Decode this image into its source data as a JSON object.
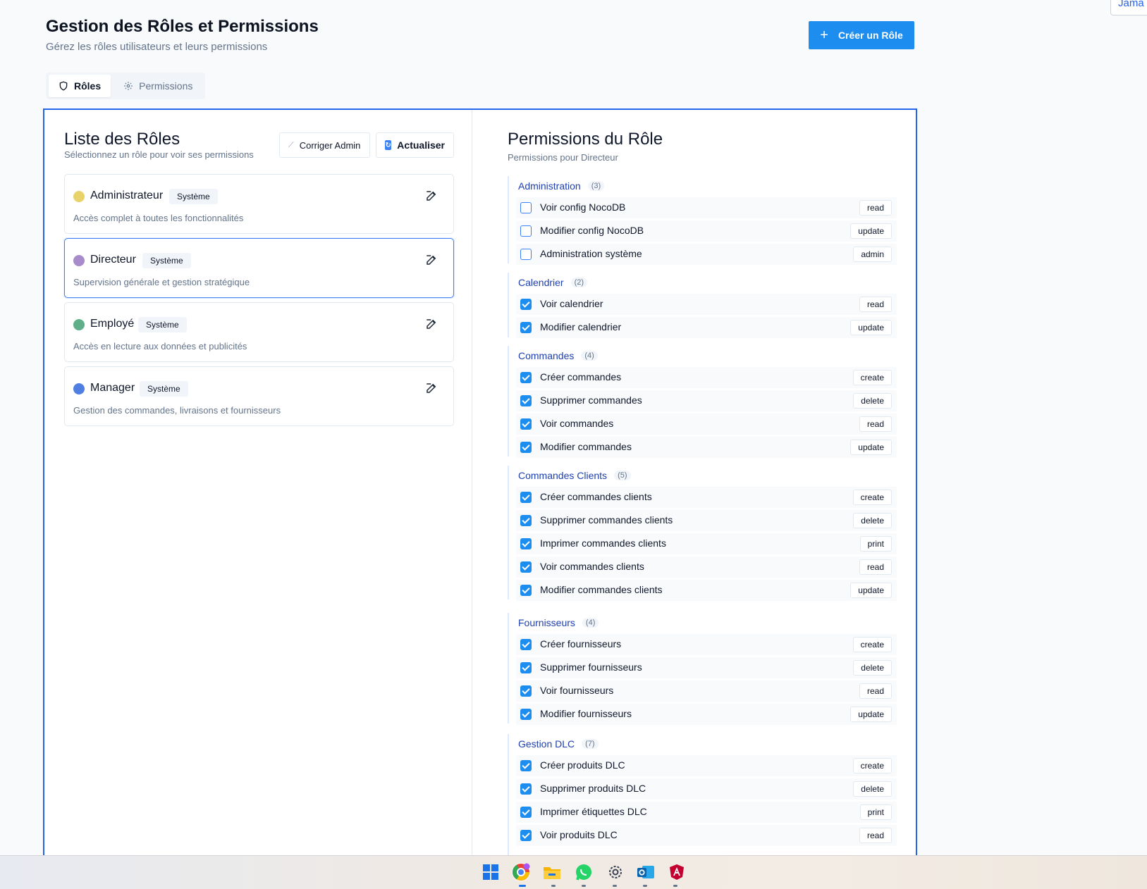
{
  "header": {
    "title": "Gestion des Rôles et Permissions",
    "subtitle": "Gérez les rôles utilisateurs et leurs permissions",
    "create_button": "Créer un Rôle",
    "corner_text": "Jama"
  },
  "tabs": [
    {
      "label": "Rôles",
      "icon": "shield-icon",
      "active": true
    },
    {
      "label": "Permissions",
      "icon": "gear-icon",
      "active": false
    }
  ],
  "roles_panel": {
    "title": "Liste des Rôles",
    "subtitle": "Sélectionnez un rôle pour voir ses permissions",
    "fix_admin_button": "Corriger Admin",
    "refresh_button": "Actualiser",
    "roles": [
      {
        "name": "Administrateur",
        "badge": "Système",
        "description": "Accès complet à toutes les fonctionnalités",
        "color": "#e8d26a",
        "selected": false
      },
      {
        "name": "Directeur",
        "badge": "Système",
        "description": "Supervision générale et gestion stratégique",
        "color": "#a78bca",
        "selected": true
      },
      {
        "name": "Employé",
        "badge": "Système",
        "description": "Accès en lecture aux données et publicités",
        "color": "#5fb08a",
        "selected": false
      },
      {
        "name": "Manager",
        "badge": "Système",
        "description": "Gestion des commandes, livraisons et fournisseurs",
        "color": "#4f7fe0",
        "selected": false
      }
    ]
  },
  "permissions_panel": {
    "title": "Permissions du Rôle",
    "subtitle": "Permissions pour Directeur",
    "groups": [
      {
        "name": "Administration",
        "count": "(3)",
        "items": [
          {
            "label": "Voir config NocoDB",
            "action": "read",
            "checked": false
          },
          {
            "label": "Modifier config NocoDB",
            "action": "update",
            "checked": false
          },
          {
            "label": "Administration système",
            "action": "admin",
            "checked": false
          }
        ]
      },
      {
        "name": "Calendrier",
        "count": "(2)",
        "items": [
          {
            "label": "Voir calendrier",
            "action": "read",
            "checked": true
          },
          {
            "label": "Modifier calendrier",
            "action": "update",
            "checked": true
          }
        ]
      },
      {
        "name": "Commandes",
        "count": "(4)",
        "items": [
          {
            "label": "Créer commandes",
            "action": "create",
            "checked": true
          },
          {
            "label": "Supprimer commandes",
            "action": "delete",
            "checked": true
          },
          {
            "label": "Voir commandes",
            "action": "read",
            "checked": true
          },
          {
            "label": "Modifier commandes",
            "action": "update",
            "checked": true
          }
        ]
      },
      {
        "name": "Commandes Clients",
        "count": "(5)",
        "items": [
          {
            "label": "Créer commandes clients",
            "action": "create",
            "checked": true
          },
          {
            "label": "Supprimer commandes clients",
            "action": "delete",
            "checked": true
          },
          {
            "label": "Imprimer commandes clients",
            "action": "print",
            "checked": true
          },
          {
            "label": "Voir commandes clients",
            "action": "read",
            "checked": true
          },
          {
            "label": "Modifier commandes clients",
            "action": "update",
            "checked": true
          }
        ]
      },
      {
        "name": "Fournisseurs",
        "count": "(4)",
        "items": [
          {
            "label": "Créer fournisseurs",
            "action": "create",
            "checked": true
          },
          {
            "label": "Supprimer fournisseurs",
            "action": "delete",
            "checked": true
          },
          {
            "label": "Voir fournisseurs",
            "action": "read",
            "checked": true
          },
          {
            "label": "Modifier fournisseurs",
            "action": "update",
            "checked": true
          }
        ]
      },
      {
        "name": "Gestion DLC",
        "count": "(7)",
        "items": [
          {
            "label": "Créer produits DLC",
            "action": "create",
            "checked": true
          },
          {
            "label": "Supprimer produits DLC",
            "action": "delete",
            "checked": true
          },
          {
            "label": "Imprimer étiquettes DLC",
            "action": "print",
            "checked": true
          },
          {
            "label": "Voir produits DLC",
            "action": "read",
            "checked": true
          }
        ]
      }
    ]
  },
  "taskbar": {
    "icons": [
      "windows-start-icon",
      "chrome-icon",
      "file-explorer-icon",
      "whatsapp-icon",
      "settings-icon",
      "outlook-icon",
      "angular-icon"
    ]
  }
}
